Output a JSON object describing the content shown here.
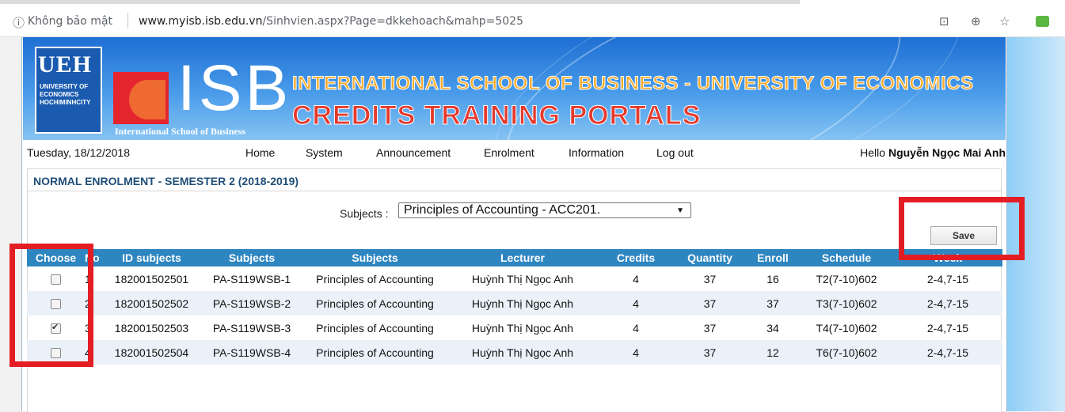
{
  "browser": {
    "security_icon": "info-circle-icon",
    "security_label": "Không bảo mật",
    "url_host": "www.myisb.isb.edu.vn",
    "url_path": "/Sinhvien.aspx?Page=dkkehoach&mahp=5025"
  },
  "banner": {
    "ueh_letters": "UEH",
    "ueh_lines": [
      "UNIVERSITY OF",
      "ECONOMICS",
      "HOCHIMINHCITY"
    ],
    "isb_letters": "ISB",
    "isb_subtitle": "International School of Business",
    "title_line1": "INTERNATIONAL SCHOOL OF BUSINESS - UNIVERSITY OF ECONOMICS",
    "title_line2": "CREDITS TRAINING PORTALS"
  },
  "navbar": {
    "date": "Tuesday, 18/12/2018",
    "items": [
      "Home",
      "System",
      "Announcement",
      "Enrolment",
      "Information",
      "Log out"
    ],
    "hello_prefix": "Hello",
    "user_name": "Nguyễn Ngọc Mai Anh"
  },
  "panel": {
    "title": "NORMAL ENROLMENT - SEMESTER 2 (2018-2019)",
    "subjects_label": "Subjects :",
    "subjects_selected": "Principles of Accounting - ACC201.",
    "save_label": "Save"
  },
  "table": {
    "headers": [
      "Choose",
      "No",
      "ID subjects",
      "Subjects",
      "Subjects",
      "Lecturer",
      "Credits",
      "Quantity",
      "Enroll",
      "Schedule",
      "Week"
    ],
    "rows": [
      {
        "checked": false,
        "no": "1",
        "id": "182001502501",
        "code": "PA-S119WSB-1",
        "subject": "Principles of Accounting",
        "lecturer": "Huỳnh Thị Ngọc Anh",
        "credits": "4",
        "quantity": "37",
        "enroll": "16",
        "schedule": "T2(7-10)602",
        "week": "2-4,7-15"
      },
      {
        "checked": false,
        "no": "2",
        "id": "182001502502",
        "code": "PA-S119WSB-2",
        "subject": "Principles of Accounting",
        "lecturer": "Huỳnh Thị Ngọc Anh",
        "credits": "4",
        "quantity": "37",
        "enroll": "37",
        "schedule": "T3(7-10)602",
        "week": "2-4,7-15"
      },
      {
        "checked": true,
        "no": "3",
        "id": "182001502503",
        "code": "PA-S119WSB-3",
        "subject": "Principles of Accounting",
        "lecturer": "Huỳnh Thị Ngọc Anh",
        "credits": "4",
        "quantity": "37",
        "enroll": "34",
        "schedule": "T4(7-10)602",
        "week": "2-4,7-15"
      },
      {
        "checked": false,
        "no": "4",
        "id": "182001502504",
        "code": "PA-S119WSB-4",
        "subject": "Principles of Accounting",
        "lecturer": "Huỳnh Thị Ngọc Anh",
        "credits": "4",
        "quantity": "37",
        "enroll": "12",
        "schedule": "T6(7-10)602",
        "week": "2-4,7-15"
      }
    ]
  },
  "colors": {
    "header_blue": "#2e86c1",
    "highlight_red": "#e41d24",
    "title_orange": "#f6aa2a",
    "title_red": "#e43a2e"
  }
}
